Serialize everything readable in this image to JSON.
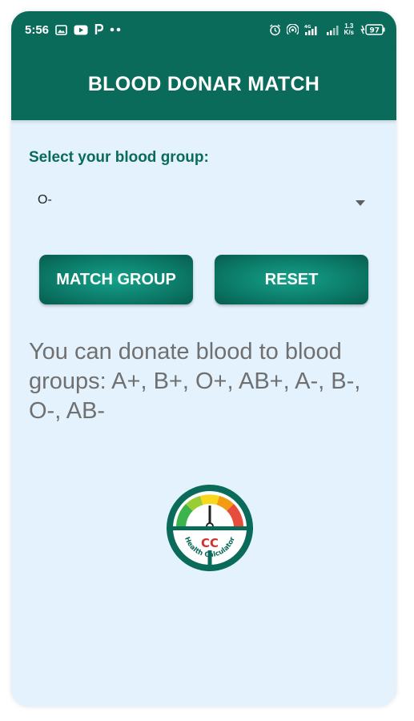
{
  "status_bar": {
    "time": "5:56",
    "network_speed_top": "1.3",
    "network_speed_bottom": "K/s",
    "battery": "97",
    "network_type": "4G"
  },
  "app_bar": {
    "title": "BLOOD DONAR MATCH"
  },
  "form": {
    "select_label": "Select your blood group:",
    "selected_group": "O-"
  },
  "buttons": {
    "match_label": "MATCH GROUP",
    "reset_label": "RESET"
  },
  "result": {
    "text": "You can donate blood to blood groups: A+, B+, O+, AB+, A-, B-, O-, AB-"
  },
  "logo": {
    "initials": "CC",
    "caption": "Health Calculator"
  },
  "colors": {
    "primary": "#0b6b5b",
    "background": "#e3f2fd",
    "result_text": "#707070"
  }
}
